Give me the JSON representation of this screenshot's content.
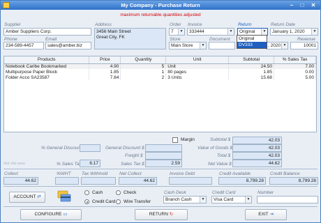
{
  "window": {
    "title": "My Company - Purchase Return"
  },
  "warning": "maximum returnable quantities adjusted",
  "supplier": {
    "label": "Supplier",
    "value": "Amber Suppliers Corp.",
    "phone_label": "Phone",
    "phone": "234-589-4457",
    "email_label": "Email",
    "email": "sales@amber.biz"
  },
  "address": {
    "label": "Address",
    "line1": "3456 Main Street",
    "line2": "Great City, FK"
  },
  "order": {
    "label": "Order",
    "value": "7",
    "invoice_label": "Invoice",
    "invoice": "333444",
    "store_label": "Store",
    "store": "Main Store",
    "document_label": "Document"
  },
  "return_type": {
    "label": "Return",
    "value": "Original",
    "options": [
      "Original",
      "DV333"
    ],
    "highlighted": "DV333"
  },
  "return_date": {
    "label": "Return Date",
    "value": "January 1, 2020",
    "partial": ", 2020"
  },
  "revenue": {
    "label": "Revenue",
    "value": "10001"
  },
  "table": {
    "headers": [
      "Products",
      "Price",
      "Quantity",
      "Unit",
      "Subtotal",
      "% Sales Tax"
    ],
    "rows": [
      [
        "Notebook Caribe Bookmarked",
        "4.90",
        "5",
        "Unit",
        "24.50",
        "7.00"
      ],
      [
        "Multipurpose Paper Block",
        "1.85",
        "1",
        "80 pages",
        "1.85",
        "0.00"
      ],
      [
        "Folder Acco SA23587",
        "7.84",
        "2",
        "3 Units",
        "15.68",
        "5.00"
      ]
    ]
  },
  "totals": {
    "margin_label": "Margin",
    "subtotal_label": "Subtotal $",
    "subtotal": "42.03",
    "pct_discount_label": "% General Discount",
    "gen_discount_label": "General Discount $",
    "value_goods_label": "Value of Goods $",
    "value_goods": "42.03",
    "freight_label": "Freight $",
    "total_label": "Total $",
    "total": "42.03",
    "pct_tax_label": "% Sales Tax",
    "pct_tax": "6.17",
    "tax_label": "Sales Tax $",
    "tax": "2.59",
    "net_label": "Net Value $",
    "net": "44.62",
    "vat_label": "Not Vat area"
  },
  "summary": {
    "collect_label": "Collect",
    "collect": "44.62",
    "wht_label": "%WHT",
    "tax_withhold_label": "Tax Withhold",
    "net_collect_label": "Net Collect",
    "net_collect": "44.62",
    "invoice_debt_label": "Invoice Debt",
    "credit_available_label": "Credit Available",
    "credit_available": "8,799.28",
    "credit_balance_label": "Credit Balance",
    "credit_balance": "8,799.28"
  },
  "payment": {
    "account_label": "ACCOUNT",
    "cash": "Cash",
    "check": "Check",
    "credit_card": "Credit Card",
    "wire": "Wire Transfer",
    "cash_desk_label": "Cash Desk",
    "cash_desk": "Branch Cash",
    "credit_card_label": "Credit Card",
    "credit_card_value": "Visa Card",
    "number_label": "Number"
  },
  "buttons": {
    "configure": "CONFIGURE",
    "return": "RETURN",
    "exit": "EXIT"
  }
}
